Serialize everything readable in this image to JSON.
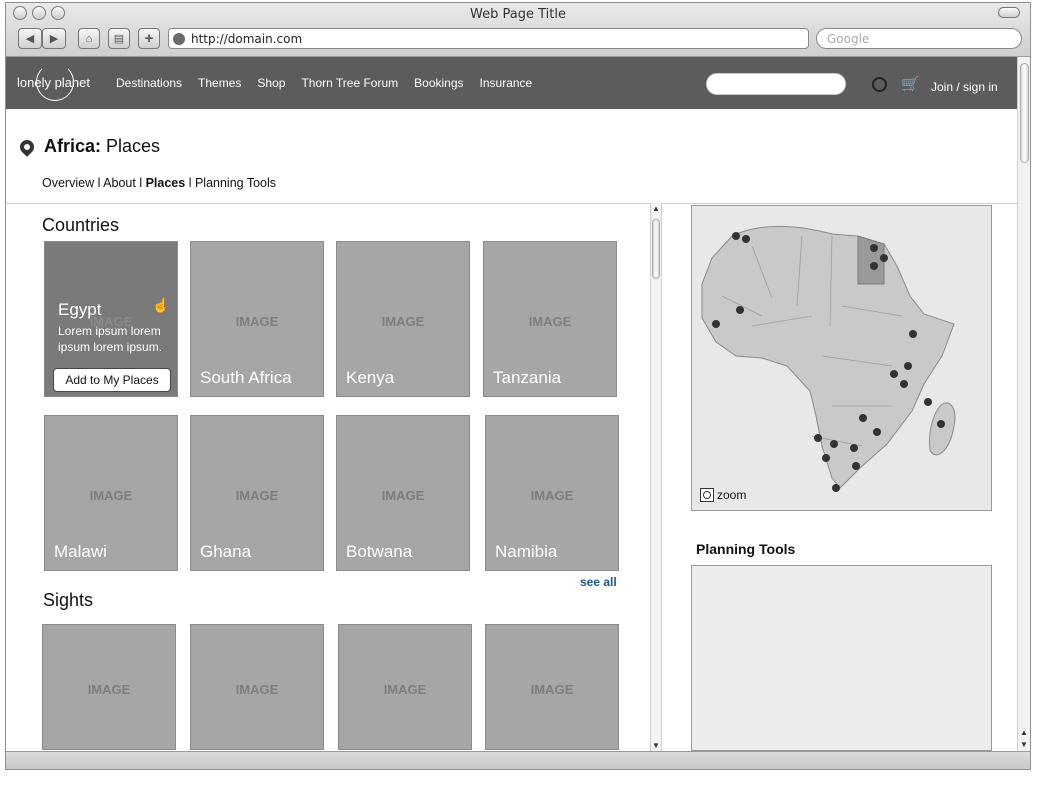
{
  "browser": {
    "window_title": "Web Page Title",
    "url": "http://domain.com",
    "search_placeholder": "Google"
  },
  "nav": {
    "logo": "lonely planet",
    "links": [
      "Destinations",
      "Themes",
      "Shop",
      "Thorn Tree Forum",
      "Bookings",
      "Insurance"
    ],
    "join": "Join / sign in"
  },
  "page": {
    "title_bold": "Africa:",
    "title_rest": "Places",
    "subnav": {
      "overview": "Overview",
      "about": "About",
      "places": "Places",
      "planning": "Planning Tools",
      "sep": "l"
    }
  },
  "countries": {
    "heading": "Countries",
    "placeholder": "IMAGE",
    "hover": {
      "name": "Egypt",
      "desc": "Lorem ipsum lorem ipsum lorem ipsum.",
      "button": "Add to My Places"
    },
    "row1": [
      "South Africa",
      "Kenya",
      "Tanzania"
    ],
    "row2": [
      "Malawi",
      "Ghana",
      "Botwana",
      "Namibia"
    ],
    "see_all": "see all"
  },
  "sights": {
    "heading": "Sights",
    "placeholder": "IMAGE"
  },
  "map": {
    "zoom_label": "zoom"
  },
  "planning_tools": {
    "heading": "Planning Tools"
  }
}
